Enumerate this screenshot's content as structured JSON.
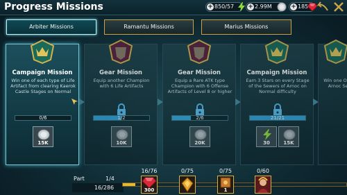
{
  "header": {
    "title": "Progress Missions",
    "energy": "850/57",
    "silver": "2.99M",
    "gems": "185"
  },
  "tabs": [
    {
      "label": "Arbiter Missions",
      "active": true
    },
    {
      "label": "Ramantu Missions",
      "active": false
    },
    {
      "label": "Marius Missions",
      "active": false
    }
  ],
  "missions": [
    {
      "name": "Campaign Mission",
      "desc": "Win one of each type of Life Artifact from clearing Kaerok Castle Stages on Normal",
      "progress": "0/6",
      "progress_fraction": 0,
      "state": "active",
      "rewards": [
        {
          "icon": "silver-coin-icon",
          "value": "15K"
        }
      ]
    },
    {
      "name": "Gear Mission",
      "desc": "Equip another Champion with 6 Life Artifacts",
      "progress": "1/2",
      "progress_fraction": 0.5,
      "state": "locked",
      "rewards": [
        {
          "icon": "silver-coin-icon",
          "value": "10K"
        }
      ]
    },
    {
      "name": "Gear Mission",
      "desc": "Equip a Rare ATK type Champion with 6 Offense Artifacts of Level 8 or higher",
      "progress": "2/6",
      "progress_fraction": 0.333,
      "state": "locked",
      "rewards": [
        {
          "icon": "silver-coin-icon",
          "value": "20K"
        }
      ]
    },
    {
      "name": "Campaign Mission",
      "desc": "Earn 3 Stars on every Stage of the Sewers of Arnoc on Normal difficulty",
      "progress": "21/21",
      "progress_fraction": 1,
      "state": "locked",
      "rewards": [
        {
          "icon": "energy-icon",
          "value": "30"
        },
        {
          "icon": "silver-coin-icon",
          "value": "15K"
        }
      ]
    },
    {
      "name": "",
      "desc": "Win one Offense Arnoc Secon",
      "progress": "",
      "state": "locked",
      "rewards": []
    }
  ],
  "bottom": {
    "part_label": "Part",
    "part_value": "1/4",
    "points": "16/286",
    "track_fraction": 0.056,
    "milestones": [
      {
        "count": "16/76",
        "icon": "ruby-gem-icon",
        "qty": "300"
      },
      {
        "count": "0/75",
        "icon": "artifact-icon",
        "qty": ""
      },
      {
        "count": "0/75",
        "icon": "scroll-icon",
        "qty": "1"
      },
      {
        "count": "0/60",
        "icon": "champion-portrait-icon",
        "qty": ""
      }
    ]
  },
  "colors": {
    "accent_gold": "#c9a34a",
    "active_tab": "#bdf4f8",
    "progress_blue": "#2f9fd3",
    "lock_blue": "#57b8e8",
    "energy_green": "#8fd93a"
  }
}
